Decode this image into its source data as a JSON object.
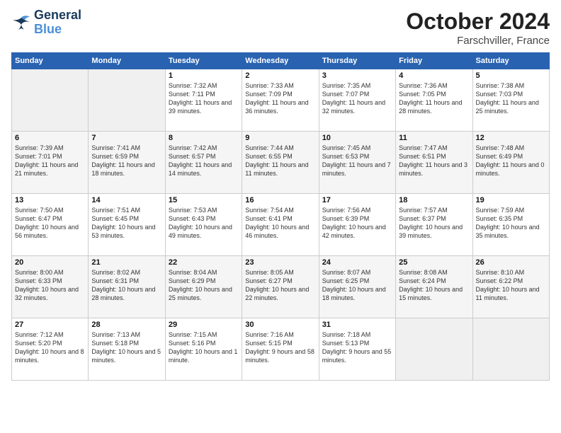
{
  "logo": {
    "line1": "General",
    "line2": "Blue"
  },
  "title": "October 2024",
  "location": "Farschviller, France",
  "days_of_week": [
    "Sunday",
    "Monday",
    "Tuesday",
    "Wednesday",
    "Thursday",
    "Friday",
    "Saturday"
  ],
  "weeks": [
    [
      {
        "day": "",
        "info": "",
        "empty": true
      },
      {
        "day": "",
        "info": "",
        "empty": true
      },
      {
        "day": "1",
        "info": "Sunrise: 7:32 AM\nSunset: 7:11 PM\nDaylight: 11 hours and 39 minutes."
      },
      {
        "day": "2",
        "info": "Sunrise: 7:33 AM\nSunset: 7:09 PM\nDaylight: 11 hours and 36 minutes."
      },
      {
        "day": "3",
        "info": "Sunrise: 7:35 AM\nSunset: 7:07 PM\nDaylight: 11 hours and 32 minutes."
      },
      {
        "day": "4",
        "info": "Sunrise: 7:36 AM\nSunset: 7:05 PM\nDaylight: 11 hours and 28 minutes."
      },
      {
        "day": "5",
        "info": "Sunrise: 7:38 AM\nSunset: 7:03 PM\nDaylight: 11 hours and 25 minutes."
      }
    ],
    [
      {
        "day": "6",
        "info": "Sunrise: 7:39 AM\nSunset: 7:01 PM\nDaylight: 11 hours and 21 minutes."
      },
      {
        "day": "7",
        "info": "Sunrise: 7:41 AM\nSunset: 6:59 PM\nDaylight: 11 hours and 18 minutes."
      },
      {
        "day": "8",
        "info": "Sunrise: 7:42 AM\nSunset: 6:57 PM\nDaylight: 11 hours and 14 minutes."
      },
      {
        "day": "9",
        "info": "Sunrise: 7:44 AM\nSunset: 6:55 PM\nDaylight: 11 hours and 11 minutes."
      },
      {
        "day": "10",
        "info": "Sunrise: 7:45 AM\nSunset: 6:53 PM\nDaylight: 11 hours and 7 minutes."
      },
      {
        "day": "11",
        "info": "Sunrise: 7:47 AM\nSunset: 6:51 PM\nDaylight: 11 hours and 3 minutes."
      },
      {
        "day": "12",
        "info": "Sunrise: 7:48 AM\nSunset: 6:49 PM\nDaylight: 11 hours and 0 minutes."
      }
    ],
    [
      {
        "day": "13",
        "info": "Sunrise: 7:50 AM\nSunset: 6:47 PM\nDaylight: 10 hours and 56 minutes."
      },
      {
        "day": "14",
        "info": "Sunrise: 7:51 AM\nSunset: 6:45 PM\nDaylight: 10 hours and 53 minutes."
      },
      {
        "day": "15",
        "info": "Sunrise: 7:53 AM\nSunset: 6:43 PM\nDaylight: 10 hours and 49 minutes."
      },
      {
        "day": "16",
        "info": "Sunrise: 7:54 AM\nSunset: 6:41 PM\nDaylight: 10 hours and 46 minutes."
      },
      {
        "day": "17",
        "info": "Sunrise: 7:56 AM\nSunset: 6:39 PM\nDaylight: 10 hours and 42 minutes."
      },
      {
        "day": "18",
        "info": "Sunrise: 7:57 AM\nSunset: 6:37 PM\nDaylight: 10 hours and 39 minutes."
      },
      {
        "day": "19",
        "info": "Sunrise: 7:59 AM\nSunset: 6:35 PM\nDaylight: 10 hours and 35 minutes."
      }
    ],
    [
      {
        "day": "20",
        "info": "Sunrise: 8:00 AM\nSunset: 6:33 PM\nDaylight: 10 hours and 32 minutes."
      },
      {
        "day": "21",
        "info": "Sunrise: 8:02 AM\nSunset: 6:31 PM\nDaylight: 10 hours and 28 minutes."
      },
      {
        "day": "22",
        "info": "Sunrise: 8:04 AM\nSunset: 6:29 PM\nDaylight: 10 hours and 25 minutes."
      },
      {
        "day": "23",
        "info": "Sunrise: 8:05 AM\nSunset: 6:27 PM\nDaylight: 10 hours and 22 minutes."
      },
      {
        "day": "24",
        "info": "Sunrise: 8:07 AM\nSunset: 6:25 PM\nDaylight: 10 hours and 18 minutes."
      },
      {
        "day": "25",
        "info": "Sunrise: 8:08 AM\nSunset: 6:24 PM\nDaylight: 10 hours and 15 minutes."
      },
      {
        "day": "26",
        "info": "Sunrise: 8:10 AM\nSunset: 6:22 PM\nDaylight: 10 hours and 11 minutes."
      }
    ],
    [
      {
        "day": "27",
        "info": "Sunrise: 7:12 AM\nSunset: 5:20 PM\nDaylight: 10 hours and 8 minutes."
      },
      {
        "day": "28",
        "info": "Sunrise: 7:13 AM\nSunset: 5:18 PM\nDaylight: 10 hours and 5 minutes."
      },
      {
        "day": "29",
        "info": "Sunrise: 7:15 AM\nSunset: 5:16 PM\nDaylight: 10 hours and 1 minute."
      },
      {
        "day": "30",
        "info": "Sunrise: 7:16 AM\nSunset: 5:15 PM\nDaylight: 9 hours and 58 minutes."
      },
      {
        "day": "31",
        "info": "Sunrise: 7:18 AM\nSunset: 5:13 PM\nDaylight: 9 hours and 55 minutes."
      },
      {
        "day": "",
        "info": "",
        "empty": true
      },
      {
        "day": "",
        "info": "",
        "empty": true
      }
    ]
  ]
}
